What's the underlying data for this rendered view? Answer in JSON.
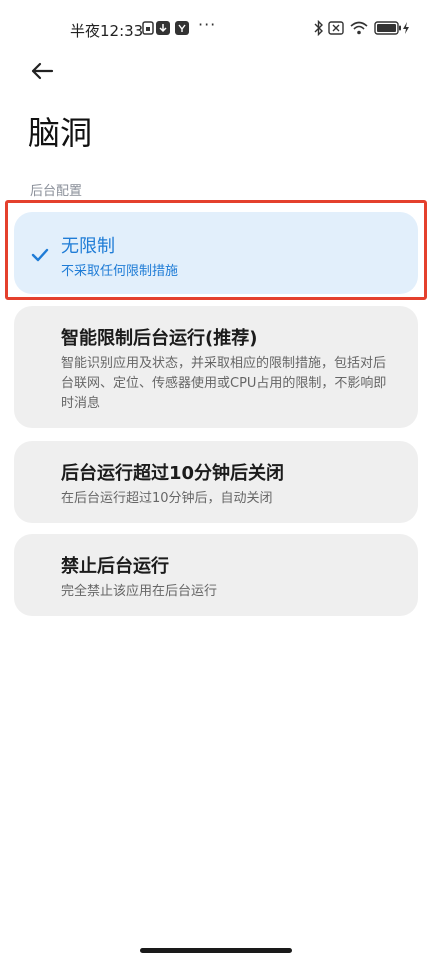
{
  "status_bar": {
    "time": "半夜12:33",
    "icons": [
      "sim-icon",
      "download-icon",
      "app-icon",
      "more-dots-icon",
      "bluetooth-icon",
      "no-sim-icon",
      "wifi-icon",
      "battery-icon",
      "charging-icon"
    ],
    "dots": "···"
  },
  "header": {
    "title": "脑洞"
  },
  "section": {
    "label": "后台配置"
  },
  "options": [
    {
      "title": "无限制",
      "desc": "不采取任何限制措施",
      "selected": true
    },
    {
      "title": "智能限制后台运行(推荐)",
      "desc": "智能识别应用及状态，并采取相应的限制措施，包括对后台联网、定位、传感器使用或CPU占用的限制，不影响即时消息",
      "selected": false
    },
    {
      "title": "后台运行超过10分钟后关闭",
      "desc": "在后台运行超过10分钟后，自动关闭",
      "selected": false
    },
    {
      "title": "禁止后台运行",
      "desc": "完全禁止该应用在后台运行",
      "selected": false
    }
  ],
  "colors": {
    "accent": "#1f7cd6",
    "selected_bg": "#e2effb",
    "card_bg": "#efefef",
    "highlight": "#e4402d"
  }
}
